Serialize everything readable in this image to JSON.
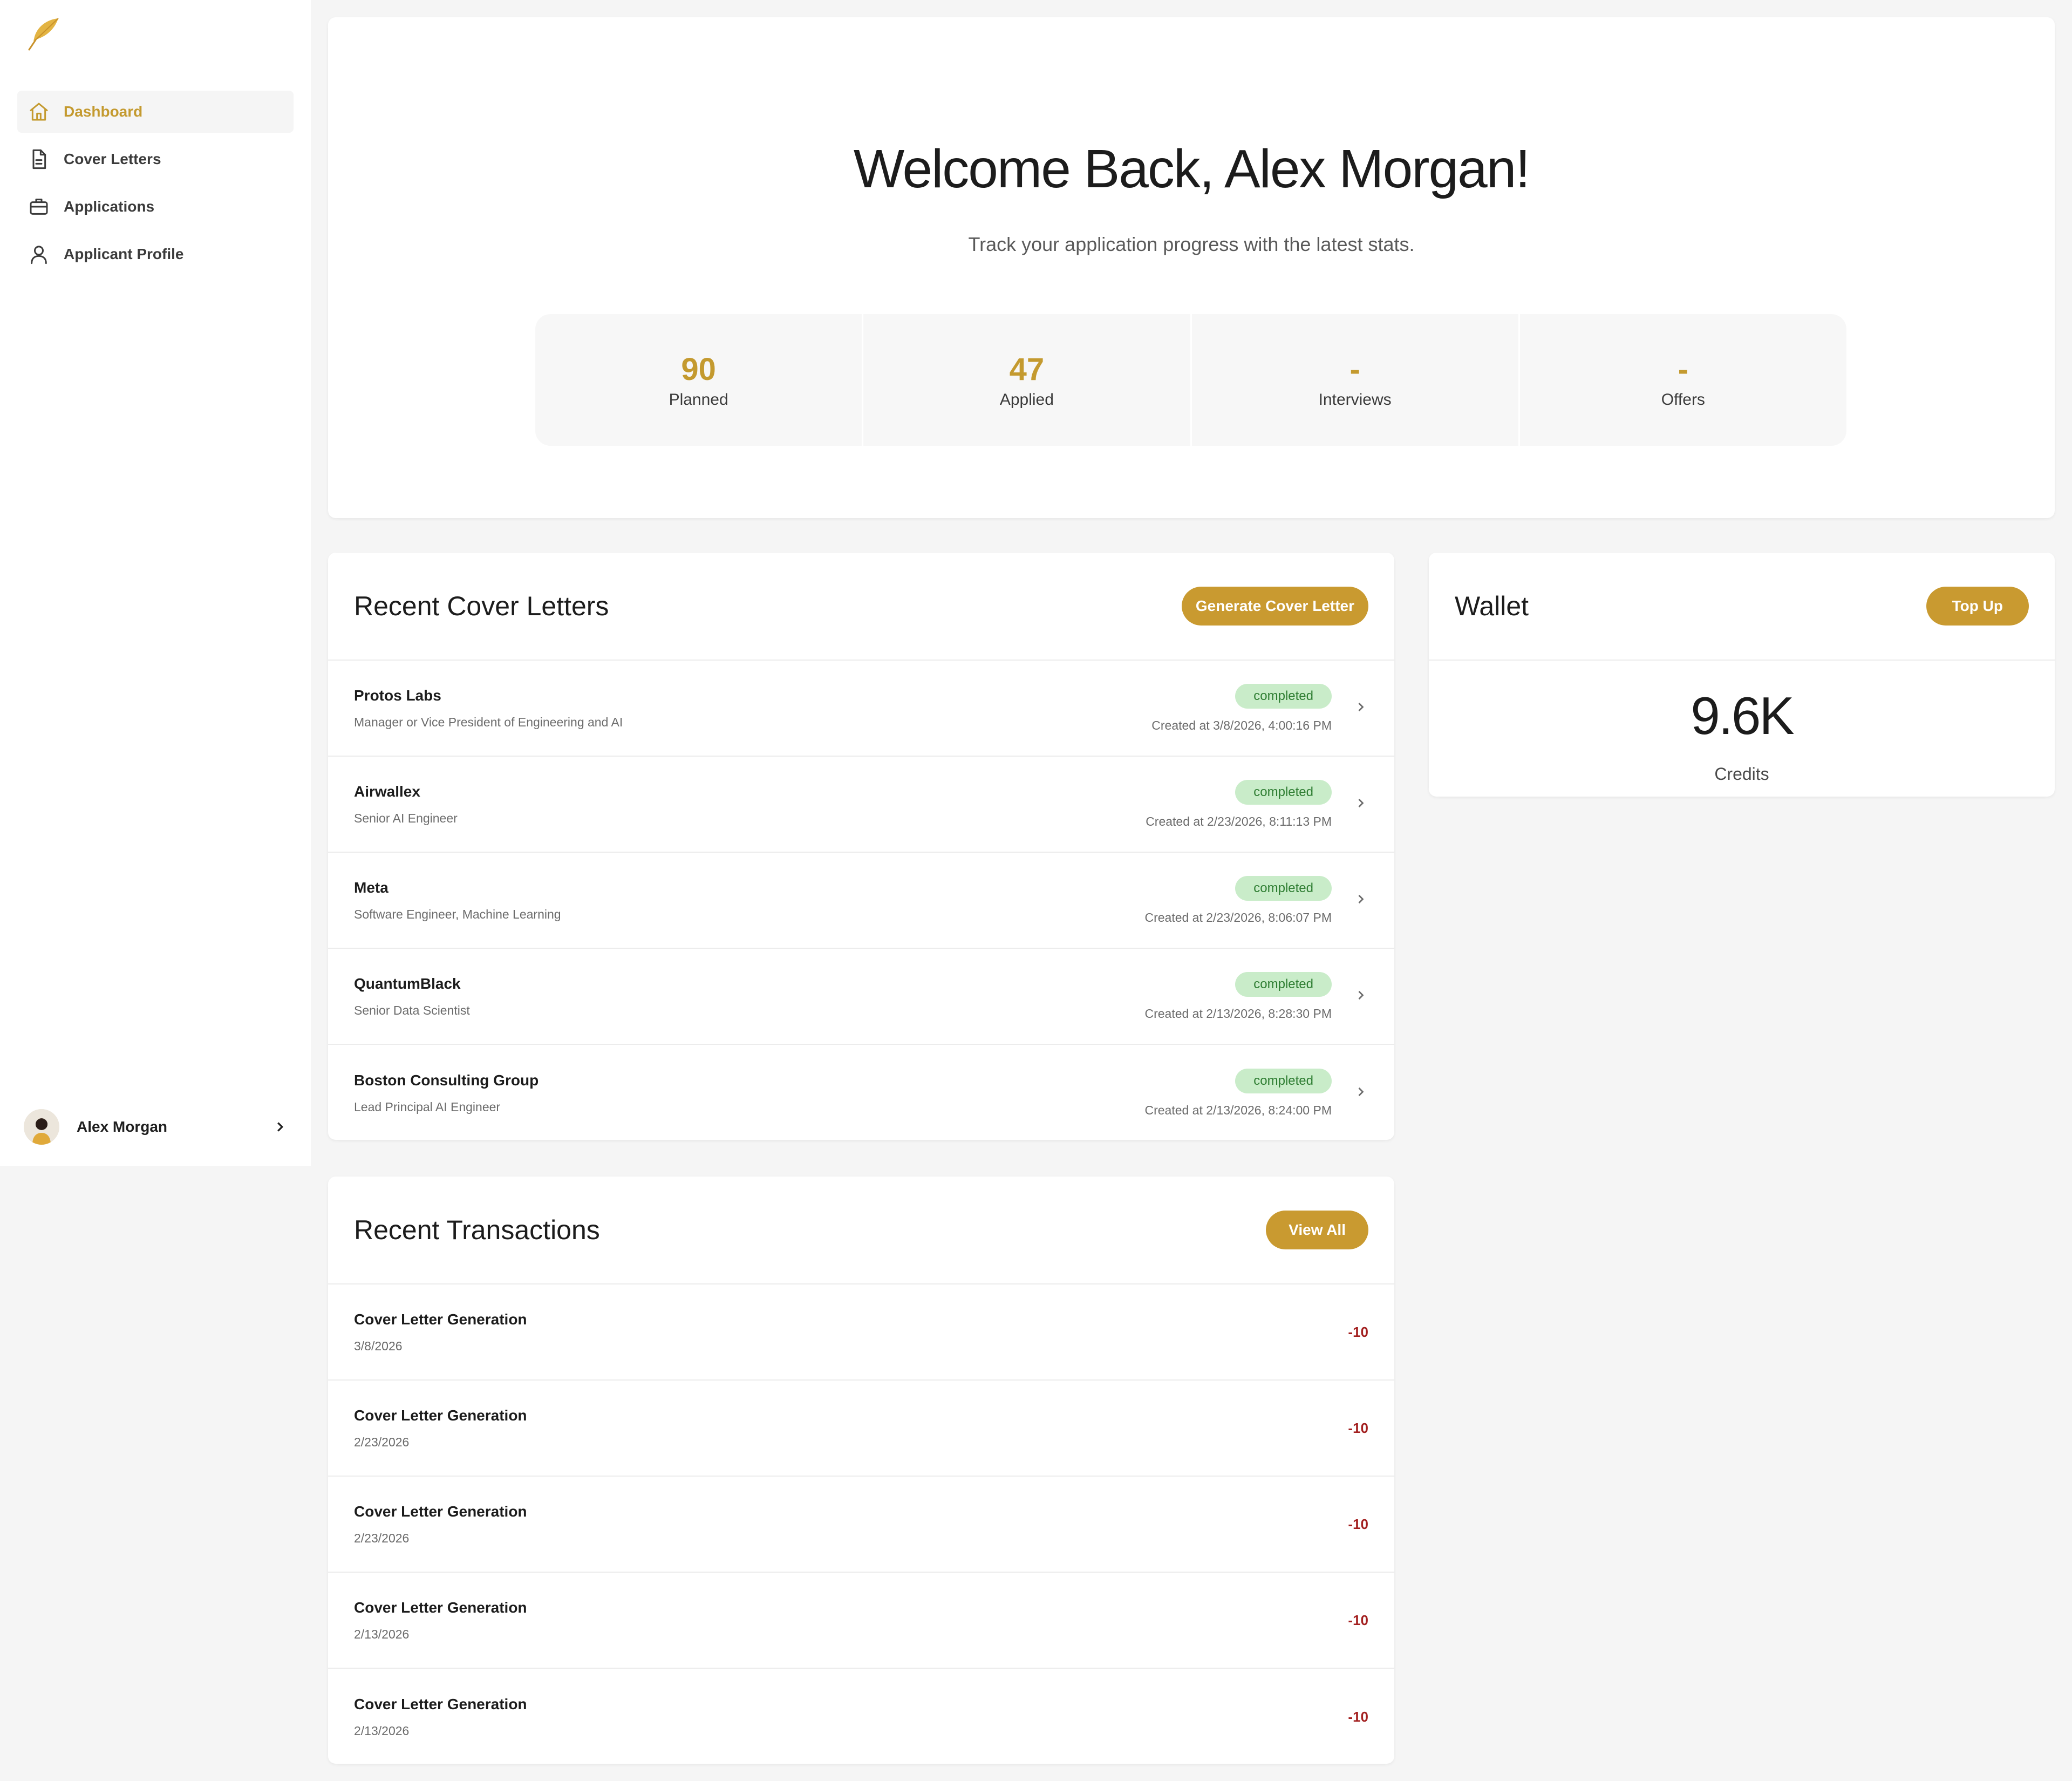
{
  "sidebar": {
    "nav": [
      {
        "label": "Dashboard",
        "icon": "home-icon",
        "active": true
      },
      {
        "label": "Cover Letters",
        "icon": "document-icon",
        "active": false
      },
      {
        "label": "Applications",
        "icon": "briefcase-icon",
        "active": false
      },
      {
        "label": "Applicant Profile",
        "icon": "user-icon",
        "active": false
      }
    ],
    "user": {
      "name": "Alex Morgan"
    }
  },
  "hero": {
    "title": "Welcome Back, Alex Morgan!",
    "subtitle": "Track your application progress with the latest stats.",
    "stats": [
      {
        "value": "90",
        "label": "Planned"
      },
      {
        "value": "47",
        "label": "Applied"
      },
      {
        "value": "-",
        "label": "Interviews"
      },
      {
        "value": "-",
        "label": "Offers"
      }
    ]
  },
  "cover_letters": {
    "title": "Recent Cover Letters",
    "button": "Generate Cover Letter",
    "items": [
      {
        "company": "Protos Labs",
        "role": "Manager or Vice President of Engineering and AI",
        "status": "completed",
        "created": "Created at 3/8/2026, 4:00:16 PM"
      },
      {
        "company": "Airwallex",
        "role": "Senior AI Engineer",
        "status": "completed",
        "created": "Created at 2/23/2026, 8:11:13 PM"
      },
      {
        "company": "Meta",
        "role": "Software Engineer, Machine Learning",
        "status": "completed",
        "created": "Created at 2/23/2026, 8:06:07 PM"
      },
      {
        "company": "QuantumBlack",
        "role": "Senior Data Scientist",
        "status": "completed",
        "created": "Created at 2/13/2026, 8:28:30 PM"
      },
      {
        "company": "Boston Consulting Group",
        "role": "Lead Principal AI Engineer",
        "status": "completed",
        "created": "Created at 2/13/2026, 8:24:00 PM"
      }
    ]
  },
  "wallet": {
    "title": "Wallet",
    "button": "Top Up",
    "value": "9.6K",
    "label": "Credits"
  },
  "transactions": {
    "title": "Recent Transactions",
    "button": "View All",
    "items": [
      {
        "title": "Cover Letter Generation",
        "date": "3/8/2026",
        "amount": "-10"
      },
      {
        "title": "Cover Letter Generation",
        "date": "2/23/2026",
        "amount": "-10"
      },
      {
        "title": "Cover Letter Generation",
        "date": "2/23/2026",
        "amount": "-10"
      },
      {
        "title": "Cover Letter Generation",
        "date": "2/13/2026",
        "amount": "-10"
      },
      {
        "title": "Cover Letter Generation",
        "date": "2/13/2026",
        "amount": "-10"
      }
    ]
  },
  "colors": {
    "accent": "#c99a30",
    "badge_bg": "#c9ecc9",
    "badge_text": "#2e7d32",
    "negative": "#a32020"
  }
}
